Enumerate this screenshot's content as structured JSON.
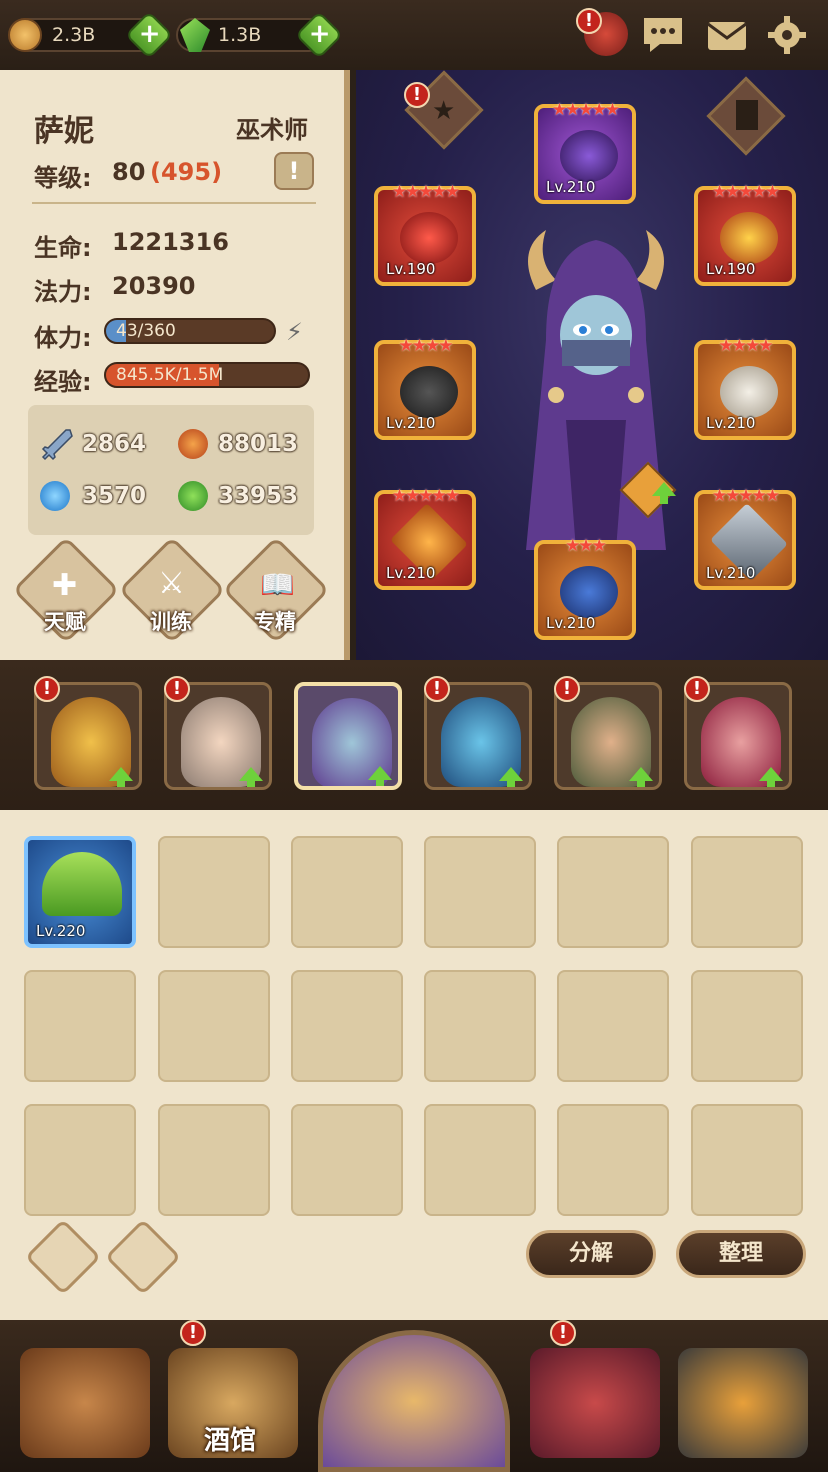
{
  "topbar": {
    "gold": "2.3B",
    "gems": "1.3B"
  },
  "hero": {
    "name": "萨妮",
    "class": "巫术师",
    "level_label": "等级:",
    "level": "80",
    "level_bonus": "(495)",
    "hp_label": "生命:",
    "hp": "1221316",
    "mp_label": "法力:",
    "mp": "20390",
    "stamina_label": "体力:",
    "stamina": "43/360",
    "stamina_fraction": 0.12,
    "exp_label": "经验:",
    "exp": "845.5K/1.5M",
    "exp_fraction": 0.56,
    "attrs": [
      "2864",
      "88013",
      "3570",
      "33953"
    ],
    "buttons": [
      "天赋",
      "训练",
      "专精"
    ]
  },
  "equipment": [
    {
      "slot": "hat",
      "level": "Lv.210",
      "stars": "★★★★★"
    },
    {
      "slot": "amulet",
      "level": "Lv.190",
      "stars": "★★★★★"
    },
    {
      "slot": "ring",
      "level": "Lv.190",
      "stars": "★★★★★"
    },
    {
      "slot": "gloves",
      "level": "Lv.210",
      "stars": "★★★★"
    },
    {
      "slot": "cloak",
      "level": "Lv.210",
      "stars": "★★★★"
    },
    {
      "slot": "weapon",
      "level": "Lv.210",
      "stars": "★★★★★"
    },
    {
      "slot": "armor",
      "level": "Lv.210",
      "stars": "★★★★★"
    },
    {
      "slot": "boots",
      "level": "Lv.210",
      "stars": "★★★"
    }
  ],
  "inventory": {
    "first_item_level": "Lv.220",
    "decompose": "分解",
    "sort": "整理"
  },
  "nav": {
    "tavern": "酒馆"
  }
}
